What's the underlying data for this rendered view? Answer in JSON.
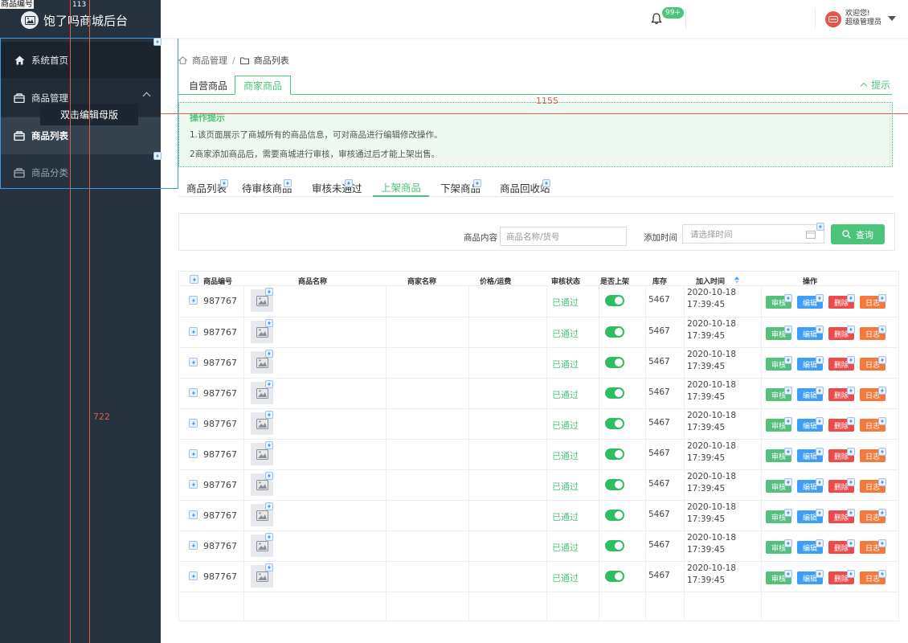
{
  "corner_label": "商品编号",
  "guides": {
    "left_tag": "113",
    "height_label": "722",
    "width_label": "1155"
  },
  "sidebar": {
    "title": "饱了吗商城后台",
    "items": [
      {
        "label": "系统首页",
        "icon": "home-icon"
      },
      {
        "label": "商品管理",
        "icon": "shop-icon"
      },
      {
        "label": "商品列表",
        "icon": "shop-icon"
      },
      {
        "label": "商品分类",
        "icon": "shop-icon"
      }
    ],
    "tooltip": "双击编辑母版"
  },
  "header": {
    "notif_count": "99+",
    "welcome_line1": "欢迎您!",
    "welcome_line2": "超级管理员"
  },
  "breadcrumb": {
    "level1": "商品管理",
    "separator": "/",
    "level2": "商品列表"
  },
  "top_tabs": [
    "自营商品",
    "商家商品"
  ],
  "tip_toggle": "提示",
  "tips": {
    "title": "操作提示",
    "line1": "1.该页面展示了商城所有的商品信息，可对商品进行编辑修改操作。",
    "line2": "2商家添加商品后，需要商城进行审核，审核通过后才能上架出售。"
  },
  "sub_tabs": [
    "商品列表",
    "待审核商品",
    "审核未通过",
    "上架商品",
    "下架商品",
    "商品回收站"
  ],
  "filter": {
    "content_label": "商品内容",
    "content_placeholder": "商品名称/货号",
    "time_label": "添加时间",
    "time_placeholder": "请选择时间",
    "search_label": "查询"
  },
  "table": {
    "headers": [
      "商品编号",
      "商品名称",
      "商家名称",
      "价格/运费",
      "审核状态",
      "是否上架",
      "库存",
      "加入时间",
      "操作"
    ],
    "rows": [
      {
        "id": "987767",
        "status": "已通过",
        "on_shelf": true,
        "stock": "5467",
        "date": "2020-10-18",
        "time": "17:39:45"
      },
      {
        "id": "987767",
        "status": "已通过",
        "on_shelf": true,
        "stock": "5467",
        "date": "2020-10-18",
        "time": "17:39:45"
      },
      {
        "id": "987767",
        "status": "已通过",
        "on_shelf": true,
        "stock": "5467",
        "date": "2020-10-18",
        "time": "17:39:45"
      },
      {
        "id": "987767",
        "status": "已通过",
        "on_shelf": true,
        "stock": "5467",
        "date": "2020-10-18",
        "time": "17:39:45"
      },
      {
        "id": "987767",
        "status": "已通过",
        "on_shelf": true,
        "stock": "5467",
        "date": "2020-10-18",
        "time": "17:39:45"
      },
      {
        "id": "987767",
        "status": "已通过",
        "on_shelf": true,
        "stock": "5467",
        "date": "2020-10-18",
        "time": "17:39:45"
      },
      {
        "id": "987767",
        "status": "已通过",
        "on_shelf": true,
        "stock": "5467",
        "date": "2020-10-18",
        "time": "17:39:45"
      },
      {
        "id": "987767",
        "status": "已通过",
        "on_shelf": true,
        "stock": "5467",
        "date": "2020-10-18",
        "time": "17:39:45"
      },
      {
        "id": "987767",
        "status": "已通过",
        "on_shelf": true,
        "stock": "5467",
        "date": "2020-10-18",
        "time": "17:39:45"
      },
      {
        "id": "987767",
        "status": "已通过",
        "on_shelf": true,
        "stock": "5467",
        "date": "2020-10-18",
        "time": "17:39:45"
      }
    ],
    "actions": [
      "审核",
      "编辑",
      "删除",
      "日志"
    ]
  },
  "colors": {
    "accent": "#4cc47a",
    "sidebar": "#26323d",
    "select_border": "#3a9ce8",
    "guide": "#e25b4a"
  }
}
